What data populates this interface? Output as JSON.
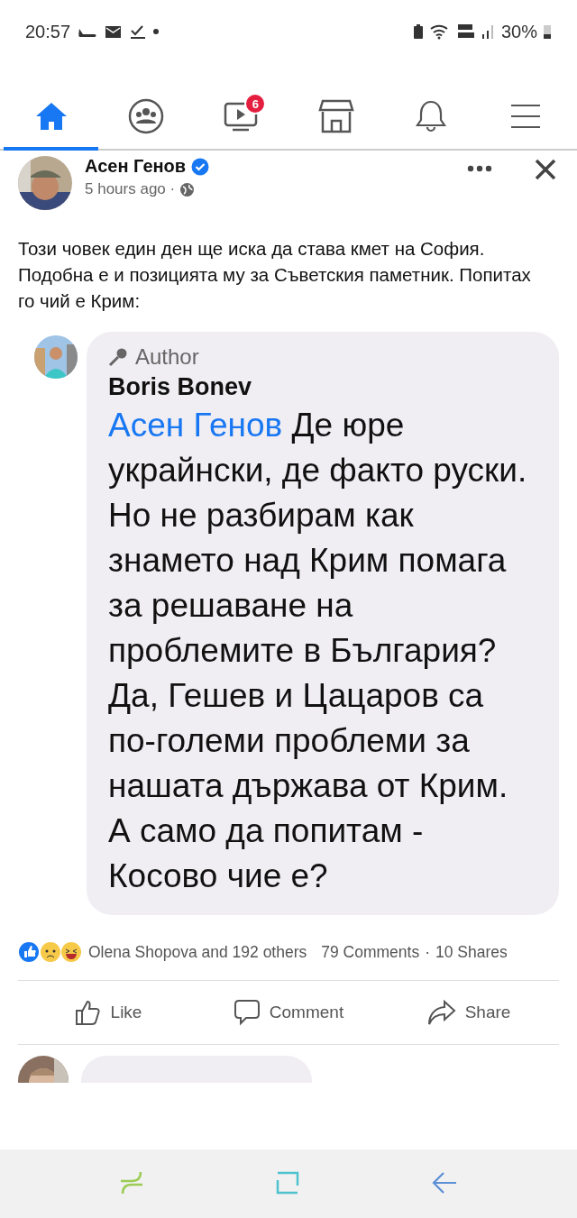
{
  "status_bar": {
    "time": "20:57",
    "battery": "30%"
  },
  "nav_tabs": [
    {
      "kind": "home",
      "selected": true
    },
    {
      "kind": "groups",
      "selected": false
    },
    {
      "kind": "watch",
      "selected": false,
      "badge": "6"
    },
    {
      "kind": "marketplace",
      "selected": false
    },
    {
      "kind": "notifications",
      "selected": false
    },
    {
      "kind": "menu",
      "selected": false
    }
  ],
  "post": {
    "author": "Асен Генов",
    "verified": true,
    "time": "5 hours ago ·",
    "text": "Този човек един ден ще иска да става кмет на София. Подобна е и позицията му за Съветския паметник. Попитах го чий е Крим:"
  },
  "comment": {
    "badge": "Author",
    "name": "Boris Bonev",
    "mention": "Асен Генов",
    "text": "Де юре украйнски, де факто руски. Но не разбирам как знамето над Крим помага за решаване на проблемите в България? Да, Гешев и Цацаров са по-големи проблеми за нашата държава от Крим.\nА само да попитам - Косово чие е?"
  },
  "reactions": {
    "summary": "Olena Shopova and 192 others",
    "comments": "79 Comments",
    "separator": "·",
    "shares": "10 Shares"
  },
  "actions": [
    {
      "kind": "like",
      "label": "Like"
    },
    {
      "kind": "comment",
      "label": "Comment"
    },
    {
      "kind": "share",
      "label": "Share"
    }
  ]
}
